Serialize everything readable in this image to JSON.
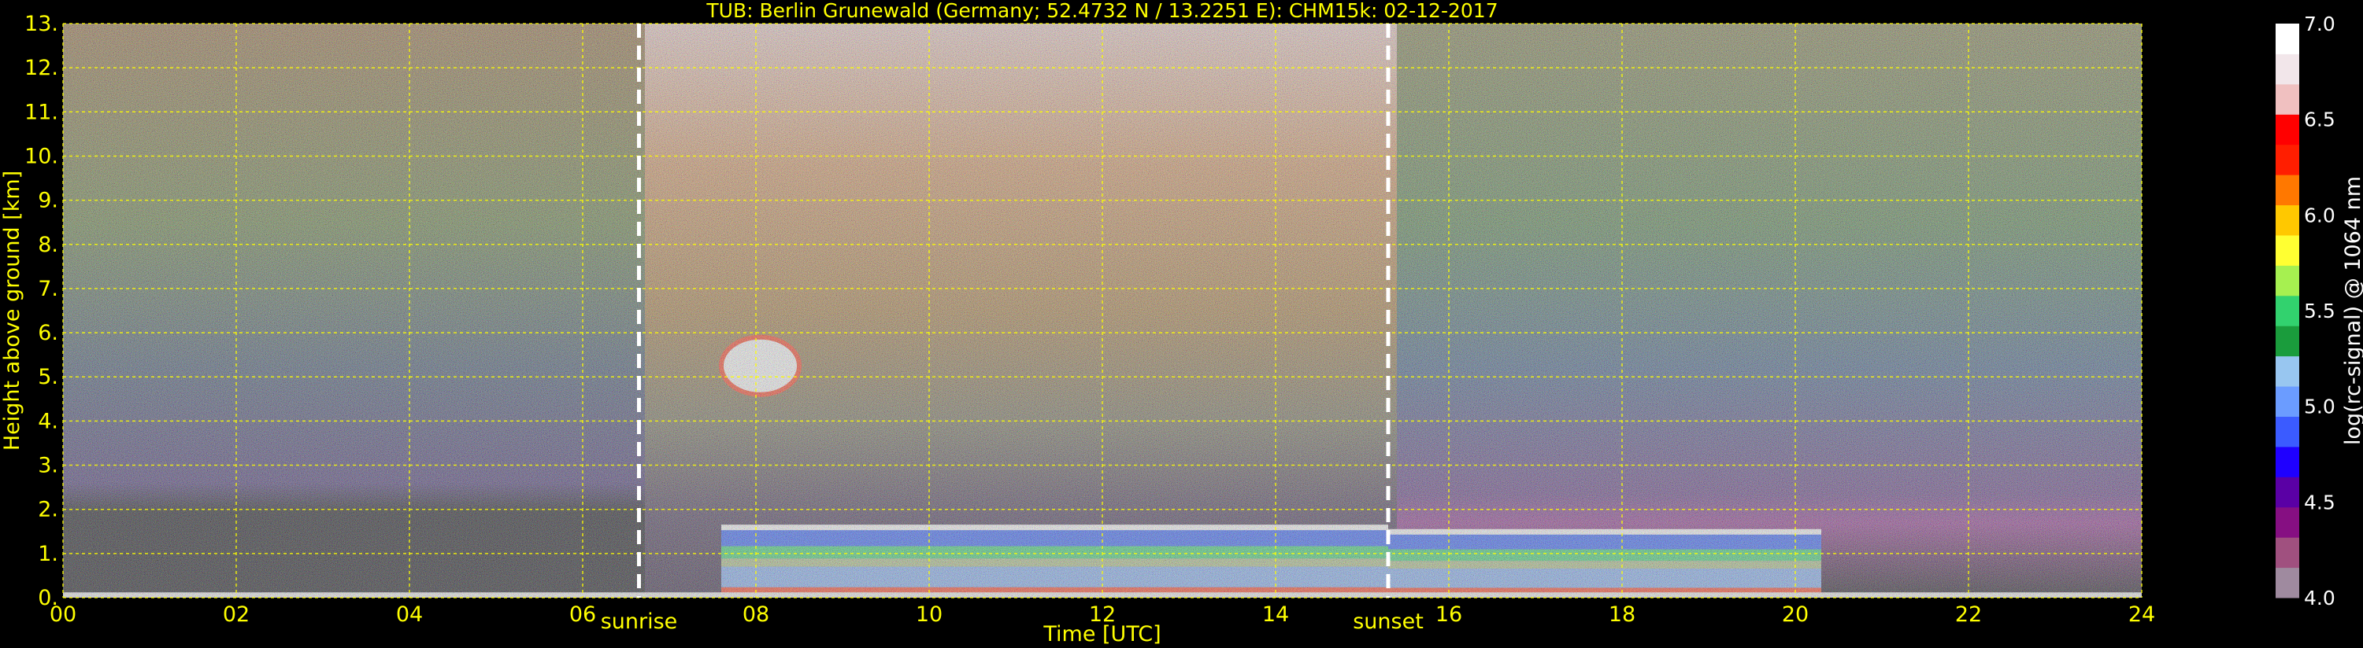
{
  "chart_data": {
    "type": "heatmap",
    "title": "TUB: Berlin Grunewald (Germany; 52.4732 N / 13.2251 E):    CHM15k: 02-12-2017",
    "xlabel": "Time [UTC]",
    "ylabel": "Height above ground [km]",
    "xlim": [
      0,
      24
    ],
    "ylim": [
      0,
      13
    ],
    "x_ticks": [
      0,
      2,
      4,
      6,
      8,
      10,
      12,
      14,
      16,
      18,
      20,
      22,
      24
    ],
    "x_tick_labels": [
      "00",
      "02",
      "04",
      "06",
      "08",
      "10",
      "12",
      "14",
      "16",
      "18",
      "20",
      "22",
      "24"
    ],
    "y_ticks": [
      0,
      1,
      2,
      3,
      4,
      5,
      6,
      7,
      8,
      9,
      10,
      11,
      12,
      13
    ],
    "y_tick_labels": [
      "0.",
      "1.",
      "2.",
      "3.",
      "4.",
      "5.",
      "6.",
      "7.",
      "8.",
      "9.",
      "10.",
      "11.",
      "12.",
      "13."
    ],
    "grid": true,
    "grid_color": "#ffff00",
    "events": [
      {
        "label": "sunrise",
        "time_utc": 6.65
      },
      {
        "label": "sunset",
        "time_utc": 15.3
      }
    ],
    "colorbar": {
      "label": "log(rc-signal) @ 1064 nm",
      "range": [
        4.0,
        7.0
      ],
      "ticks": [
        4.0,
        4.5,
        5.0,
        5.5,
        6.0,
        6.5,
        7.0
      ],
      "tick_labels": [
        "4.0",
        "4.5",
        "5.0",
        "5.5",
        "6.0",
        "6.5",
        "7.0"
      ],
      "colors": [
        "#9f8a9f",
        "#a0507f",
        "#860f82",
        "#5a00a5",
        "#1f00ff",
        "#3b5bff",
        "#6b9cff",
        "#98c6f0",
        "#1a9c3c",
        "#32d26e",
        "#a6f050",
        "#ffff32",
        "#ffc800",
        "#ff7800",
        "#ff1e00",
        "#ff0000",
        "#f0c0c0",
        "#f2e6ea",
        "#ffffff"
      ]
    },
    "features": [
      {
        "name": "cloud",
        "t_start": 7.6,
        "t_end": 8.5,
        "h_bottom": 4.6,
        "h_top": 5.9
      },
      {
        "name": "boundary_layer_top",
        "t_start": 7.6,
        "t_end": 15.3,
        "height_km": 1.6
      },
      {
        "name": "evening_layer_top",
        "t_start": 15.3,
        "t_end": 20.3,
        "height_km": 1.5
      }
    ]
  }
}
